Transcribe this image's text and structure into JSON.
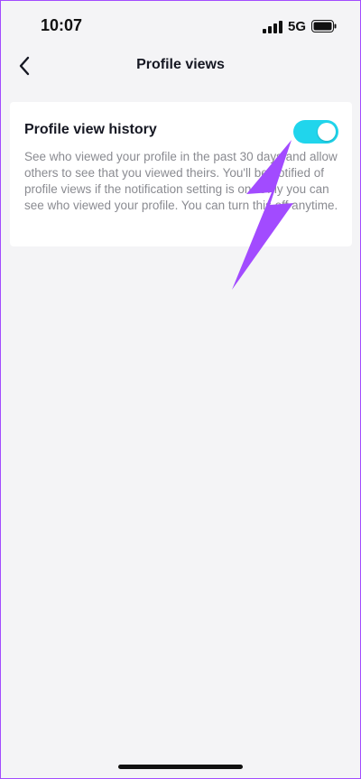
{
  "status_bar": {
    "time": "10:07",
    "network": "5G",
    "signal_icon": "signal-bars-icon",
    "battery_icon": "battery-icon"
  },
  "nav": {
    "back_icon": "chevron-left-icon",
    "title": "Profile views"
  },
  "setting": {
    "title": "Profile view history",
    "description": "See who viewed your profile in the past 30 days and allow others to see that you viewed theirs. You'll be notified of profile views if the notification setting is on. Only you can see who viewed your profile. You can turn this off anytime.",
    "toggle_on": true,
    "toggle_color": "#20d5ec"
  },
  "annotation": {
    "arrow_color": "#a24bff",
    "arrow_icon": "pointer-arrow-icon"
  }
}
